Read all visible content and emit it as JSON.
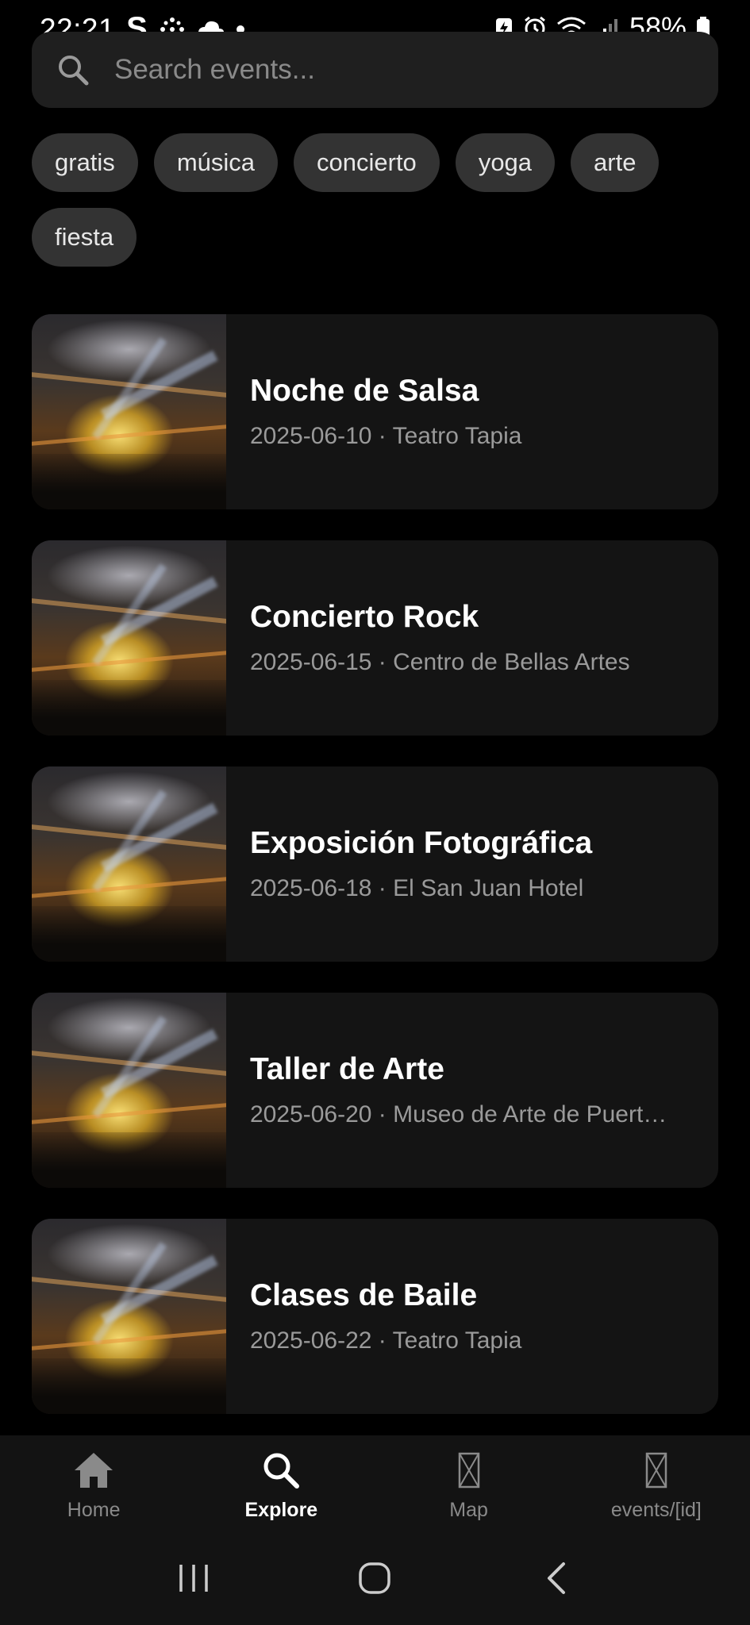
{
  "status_bar": {
    "time": "22:21",
    "carrier_glyph": "S",
    "battery": "58%"
  },
  "search": {
    "placeholder": "Search events..."
  },
  "chips": [
    "gratis",
    "música",
    "concierto",
    "yoga",
    "arte",
    "fiesta"
  ],
  "events": [
    {
      "title": "Noche de Salsa",
      "meta": "2025-06-10 · Teatro Tapia"
    },
    {
      "title": "Concierto Rock",
      "meta": "2025-06-15 · Centro de Bellas Artes"
    },
    {
      "title": "Exposición Fotográfica",
      "meta": "2025-06-18 · El San Juan Hotel"
    },
    {
      "title": "Taller de Arte",
      "meta": "2025-06-20 · Museo de Arte de Puert…"
    },
    {
      "title": "Clases de Baile",
      "meta": "2025-06-22 · Teatro Tapia"
    }
  ],
  "tabs": [
    {
      "label": "Home",
      "icon": "home-icon",
      "active": false
    },
    {
      "label": "Explore",
      "icon": "search-icon",
      "active": true
    },
    {
      "label": "Map",
      "icon": "missing-icon",
      "active": false
    },
    {
      "label": "events/[id]",
      "icon": "missing-icon",
      "active": false
    }
  ],
  "colors": {
    "background": "#000000",
    "card": "#141414",
    "chip": "#333333",
    "search_bar": "#1f1f1f",
    "tab_bar": "#131313",
    "meta_text": "#9a9a9a"
  }
}
